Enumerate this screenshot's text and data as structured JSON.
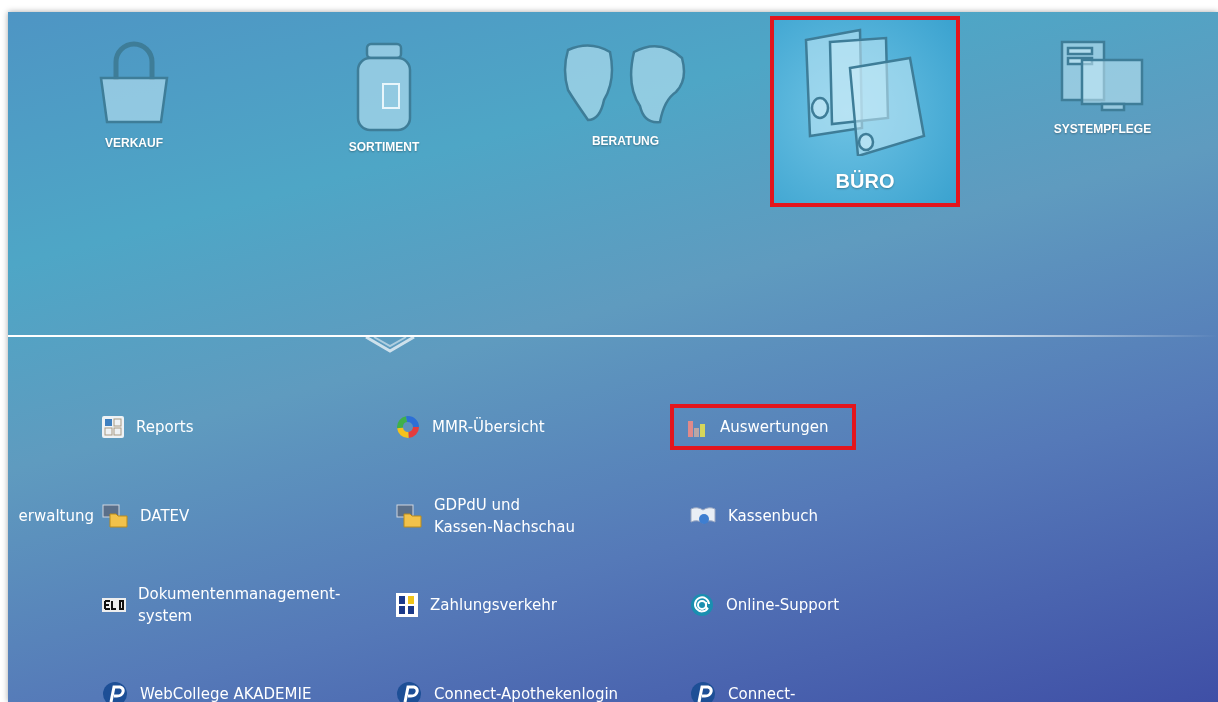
{
  "categories": [
    {
      "label": "VERKAUF",
      "kind": "bag",
      "selected": false
    },
    {
      "label": "SORTIMENT",
      "kind": "jar",
      "selected": false
    },
    {
      "label": "BERATUNG",
      "kind": "heads",
      "selected": false
    },
    {
      "label": "BÜRO",
      "kind": "binders",
      "selected": true
    },
    {
      "label": "SYSTEMPFLEGE",
      "kind": "computer",
      "selected": false
    }
  ],
  "menu_rows": [
    {
      "items": [
        {
          "label": "Reports",
          "kind": "tiles",
          "highlighted": false
        },
        {
          "label": "MMR-Übersicht",
          "kind": "ring",
          "highlighted": false
        },
        {
          "label": "Auswertungen",
          "kind": "bars",
          "highlighted": true
        }
      ]
    },
    {
      "items": [
        {
          "label": "erwaltung",
          "kind": "text",
          "highlighted": false
        },
        {
          "label": "DATEV",
          "kind": "folder",
          "highlighted": false
        },
        {
          "label": "GDPdU und\nKassen-Nachschau",
          "kind": "folder",
          "highlighted": false
        },
        {
          "label": "Kassenbuch",
          "kind": "book",
          "highlighted": false
        }
      ]
    },
    {
      "items": [
        {
          "label": "Dokumentenmanagement-\nsystem",
          "kind": "elo",
          "highlighted": false
        },
        {
          "label": "Zahlungsverkehr",
          "kind": "sepa",
          "highlighted": false
        },
        {
          "label": "Online-Support",
          "kind": "at",
          "highlighted": false
        }
      ]
    },
    {
      "items": [
        {
          "label": "WebCollege AKADEMIE",
          "kind": "p",
          "highlighted": false
        },
        {
          "label": "Connect-Apothekenlogin",
          "kind": "p",
          "highlighted": false
        },
        {
          "label": "Connect-",
          "kind": "p",
          "highlighted": false
        }
      ]
    }
  ]
}
